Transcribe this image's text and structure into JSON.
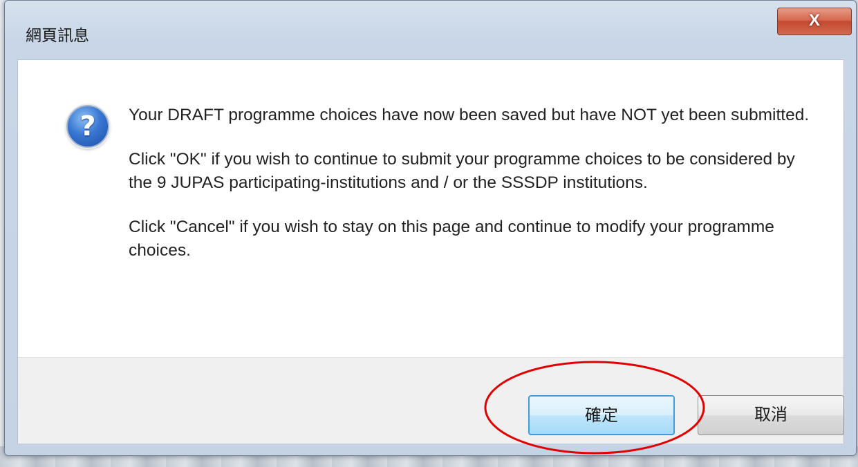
{
  "dialog": {
    "title": "網頁訊息",
    "close_glyph": "X",
    "icon": "question-icon",
    "message_paragraphs": [
      "Your DRAFT programme choices have now been saved but have NOT yet been submitted.",
      "Click \"OK\" if you wish to continue to submit your programme choices to be considered by the 9 JUPAS participating-institutions and / or the SSSDP institutions.",
      "Click \"Cancel\" if you wish to stay on this page and continue to modify your programme choices."
    ],
    "ok_label": "確定",
    "cancel_label": "取消"
  },
  "annotation": {
    "shape": "ellipse",
    "color": "#e00000",
    "target": "ok-button"
  },
  "colors": {
    "close_button": "#c34a30",
    "ok_button_border": "#3c9de3",
    "icon_blue": "#2a63c0"
  }
}
